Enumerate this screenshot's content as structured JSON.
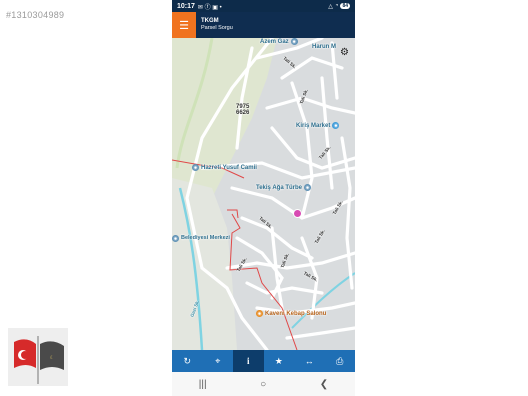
{
  "listing_id": "#1310304989",
  "status_bar": {
    "time": "10:17",
    "status_icons": "✉ ⓕ ▣ •",
    "battery": "84"
  },
  "app_bar": {
    "title": "TKGM",
    "subtitle": "Parsel Sorgu"
  },
  "map": {
    "pois": [
      {
        "name": "Azem Gaz"
      },
      {
        "name": "Harun M"
      },
      {
        "name": "Kiriş Market"
      },
      {
        "name": "Hazreti Yusuf Camii"
      },
      {
        "name": "Tekiş Ağa Türbe"
      },
      {
        "name": "Belediyesi Merkezi"
      },
      {
        "name": "Kaveni Kebap Salonu"
      }
    ],
    "parcel_label": "7975\n6626",
    "street_labels": [
      "Tali Sk.",
      "Tali Sk.",
      "Tali Sk.",
      "Tali Sk.",
      "Tali Sk.",
      "Tali Sk.",
      "Tali Sk.",
      "Tali Sk.",
      "Tali Sk.",
      "Gazi Sk."
    ]
  },
  "toolbar": {
    "buttons": [
      {
        "icon": "refresh-icon"
      },
      {
        "icon": "locate-icon"
      },
      {
        "icon": "info-icon"
      },
      {
        "icon": "star-icon"
      },
      {
        "icon": "measure-icon"
      },
      {
        "icon": "print-icon"
      }
    ],
    "active_index": 2
  },
  "nav_bar": {
    "buttons": [
      "recent-apps-icon",
      "home-icon",
      "back-icon"
    ]
  }
}
